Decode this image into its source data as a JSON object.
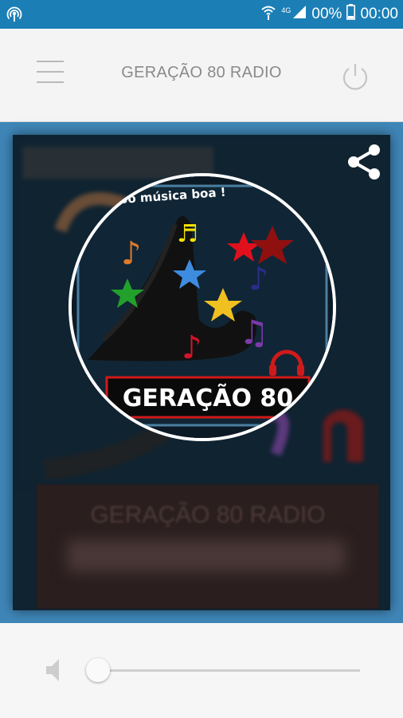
{
  "status_bar": {
    "network": "4G",
    "battery": "00%",
    "time": "00:00"
  },
  "toolbar": {
    "title": "GERAÇÃO 80 RADIO",
    "menu_icon": "hamburger-icon",
    "power_icon": "power-icon"
  },
  "player": {
    "share_icon": "share-icon",
    "logo_text": "GERAÇÃO 80",
    "logo_tagline": "Só música boa !",
    "station_name": "GERAÇÃO 80 RADIO"
  },
  "volume": {
    "icon": "volume-icon",
    "level": 0
  },
  "colors": {
    "status_bar": "#1b7fb6",
    "accent": "#3f86b8"
  }
}
